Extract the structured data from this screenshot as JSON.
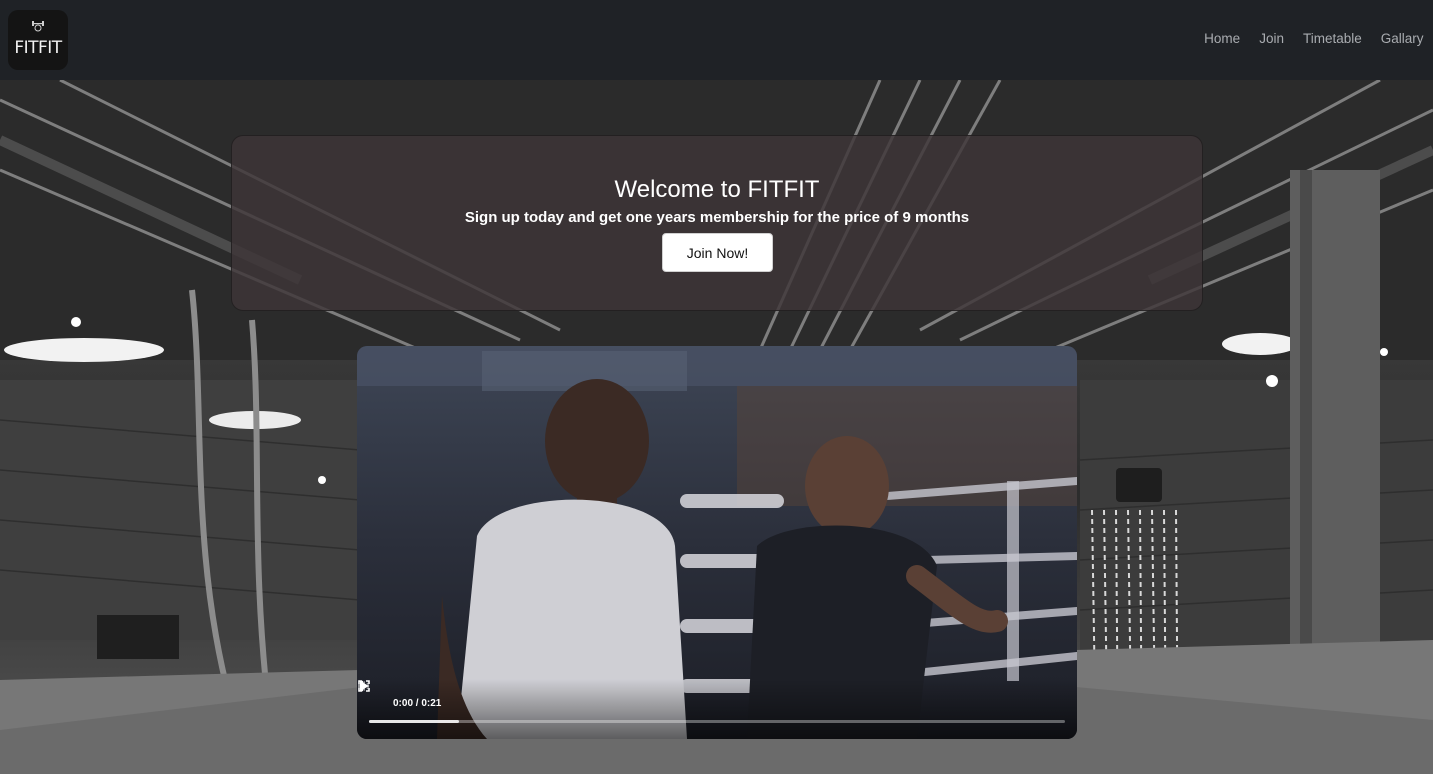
{
  "brand": {
    "logo_text": "FITFIT"
  },
  "nav": {
    "items": [
      {
        "label": "Home"
      },
      {
        "label": "Join"
      },
      {
        "label": "Timetable"
      },
      {
        "label": "Gallary"
      }
    ]
  },
  "hero": {
    "title": "Welcome to FITFIT",
    "subtitle": "Sign up today and get one years membership for the price of 9 months",
    "cta_label": "Join Now!"
  },
  "video": {
    "time_display": "0:00 / 0:21",
    "buffered_fraction": 0.13,
    "played_fraction": 0.0,
    "icons": [
      "play-icon",
      "volume-icon",
      "fullscreen-icon",
      "more-options-icon"
    ]
  },
  "colors": {
    "navbar_bg": "#1f2226",
    "nav_link": "#a9acb0",
    "hero_bg": "#3e3638",
    "button_bg": "#ffffff"
  }
}
